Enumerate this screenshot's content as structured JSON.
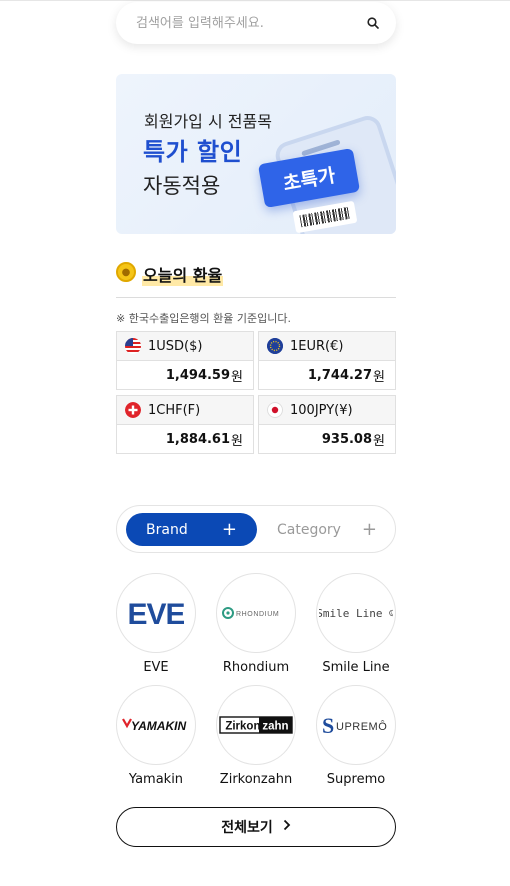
{
  "search": {
    "placeholder": "검색어를 입력해주세요.",
    "icon": "search-icon"
  },
  "banner": {
    "line1": "회원가입 시 전품목",
    "line2": "특가 할인",
    "line3": "자동적용",
    "ticket_label": "초특가",
    "accent_color": "#1f4fcf"
  },
  "exchange": {
    "title": "오늘의 환율",
    "note": "※ 한국수출입은행의 환율 기준입니다.",
    "unit": "원",
    "rates": [
      {
        "currency": "1USD($)",
        "value": "1,494.59",
        "flag": "us-flag-icon"
      },
      {
        "currency": "1EUR(€)",
        "value": "1,744.27",
        "flag": "eu-flag-icon"
      },
      {
        "currency": "1CHF(F)",
        "value": "1,884.61",
        "flag": "ch-flag-icon"
      },
      {
        "currency": "100JPY(¥)",
        "value": "935.08",
        "flag": "jp-flag-icon"
      }
    ]
  },
  "tabs": {
    "brand": "Brand",
    "category": "Category",
    "active_color": "#0b49b5"
  },
  "brands": [
    {
      "name": "EVE",
      "logo_text": "EVE"
    },
    {
      "name": "Rhondium",
      "logo_text": "RHONDIUM"
    },
    {
      "name": "Smile Line",
      "logo_text": "Smile Line ☺"
    },
    {
      "name": "Yamakin",
      "logo_text": "YAMAKIN"
    },
    {
      "name": "Zirkonzahn",
      "logo_text": "Zirkonzahn"
    },
    {
      "name": "Supremo",
      "logo_text": "UPREMÔ"
    }
  ],
  "view_all": {
    "label": "전체보기"
  }
}
